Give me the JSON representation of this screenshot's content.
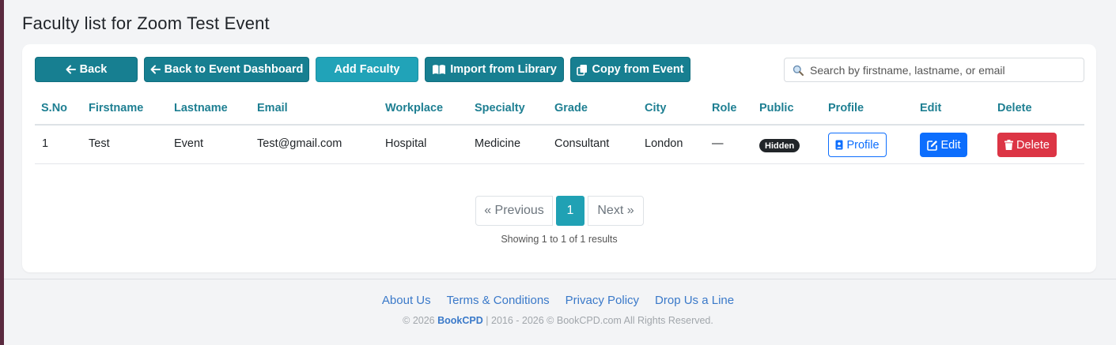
{
  "page": {
    "title": "Faculty list for Zoom Test Event"
  },
  "toolbar": {
    "back": "Back",
    "back_dashboard": "Back to Event Dashboard",
    "add_faculty": "Add Faculty",
    "import_library": "Import from Library",
    "copy_event": "Copy from Event"
  },
  "search": {
    "placeholder": "Search by firstname, lastname, or email",
    "value": ""
  },
  "table": {
    "headers": [
      "S.No",
      "Firstname",
      "Lastname",
      "Email",
      "Workplace",
      "Specialty",
      "Grade",
      "City",
      "Role",
      "Public",
      "Profile",
      "Edit",
      "Delete"
    ],
    "rows": [
      {
        "sno": "1",
        "firstname": "Test",
        "lastname": "Event",
        "email": "Test@gmail.com",
        "workplace": "Hospital",
        "specialty": "Medicine",
        "grade": "Consultant",
        "city": "London",
        "role": "—",
        "public": "Hidden",
        "profile": "Profile",
        "edit": "Edit",
        "delete": "Delete"
      }
    ]
  },
  "pagination": {
    "prev": "« Previous",
    "current": "1",
    "next": "Next »",
    "summary": "Showing 1 to 1 of 1 results"
  },
  "footer": {
    "links": [
      "About Us",
      "Terms & Conditions",
      "Privacy Policy",
      "Drop Us a Line"
    ],
    "copyright_prefix": "© 2026",
    "brand": "BookCPD",
    "copyright_suffix": "|  2016 - 2026 © BookCPD.com All Rights Reserved."
  },
  "colors": {
    "accent": "#177f91",
    "accent_light": "#21a3b8",
    "primary": "#0d6efd",
    "danger": "#dc3545",
    "link": "#3a79c9"
  },
  "icons": [
    "arrow-left-icon",
    "book-open-icon",
    "copy-icon",
    "search-icon",
    "person-badge-icon",
    "edit-icon",
    "trash-icon"
  ]
}
